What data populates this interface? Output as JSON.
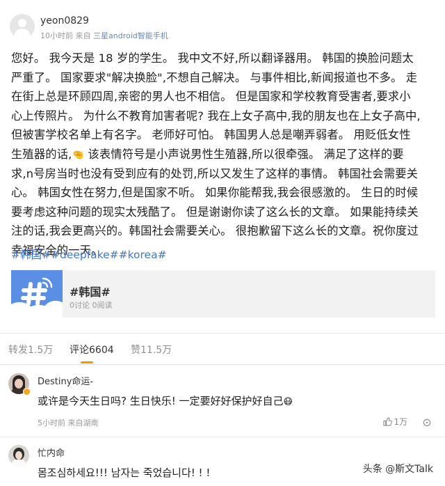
{
  "post": {
    "username": "yeon0829",
    "time": "10小时前",
    "source_prefix": "来自",
    "device": "三星android智能手机",
    "paragraph_lines": [
      "您好。 我今天是 18 岁的学生。 我中文不好,所以翻译器用。 韩国的换脸问题太",
      "严重了。 国家要求\"解决换脸\",不想自己解决。 与事件相比,新闻报道也不多。 走",
      "在街上总是环顾四周,亲密的男人也不相信。 但是国家和学校教育受害者,要求小",
      "心上传照片。 为什么不教育加害者呢? 我在上女子高中,我的朋友也在上女子高中,",
      "但被害学校名单上有名字。 老师好可怕。 韩国男人总是嘲弄弱者。 用贬低女性",
      "生殖器的话,",
      " 该表情符号是小声说男性生殖器,所以很牵强。 满足了这样的要",
      "求,n号房当时也没有受到应有的处罚,所以又发生了这样的事情。 韩国社会需要关",
      "心。 韩国女性在努力,但是国家不听。 如果你能帮我,我会很感激的。 生日的时候",
      "要考虑这种问题的现实太残酷了。 但是谢谢你读了这么长的文章。 如果能持续关",
      "注的话,我会更高兴的。韩国社会需要关心。 很抱歉留下这么长的文章。祝你度过",
      "幸福安全的一天。"
    ],
    "emoji": "🤏",
    "hashtags": "#韩国##deepfake##korea#",
    "topic": {
      "title": "#韩国#",
      "stats": "0讨论 0阅读"
    }
  },
  "tabs": {
    "repost": "转发1.5万",
    "comments": "评论6604",
    "likes": "赞11.5万"
  },
  "comments": [
    {
      "name": "Destiny命运-",
      "text": "或许是今天生日吗? 生日快乐! 一定要好好保护好自己",
      "emoji": "😷",
      "time": "5小时前",
      "source": "来自湖南",
      "likes": "1万"
    },
    {
      "name": "忙内命",
      "text": "몸조심하세요!!! 남자는 죽었습니다! ! !"
    }
  ],
  "watermark": "头条 @斯文Talk",
  "colors": {
    "link": "#3c78d8",
    "tab_accent": "#f39800",
    "topic_blue": "#5b8fe6"
  }
}
